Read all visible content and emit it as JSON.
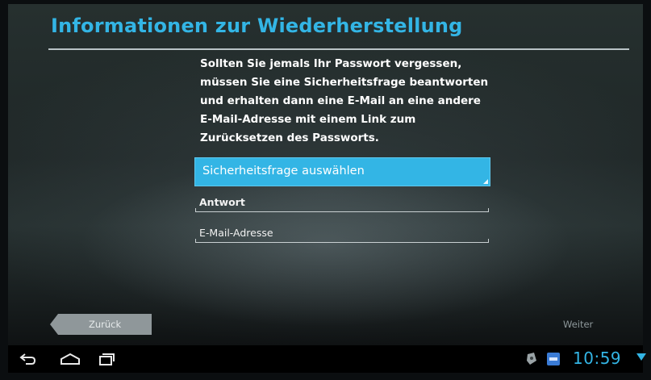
{
  "header": {
    "title": "Informationen zur Wiederherstellung"
  },
  "info_lines": [
    "Sollten Sie jemals Ihr Passwort vergessen,",
    "müssen Sie eine Sicherheitsfrage beantworten",
    "und erhalten dann eine E-Mail an eine andere",
    "E-Mail-Adresse mit einem Link zum",
    "Zurücksetzen des Passworts."
  ],
  "form": {
    "security_question_label": "Sicherheitsfrage auswählen",
    "answer_placeholder": "Antwort",
    "email_placeholder": "E-Mail-Adresse"
  },
  "footer": {
    "back_label": "Zurück",
    "next_label": "Weiter"
  },
  "system_bar": {
    "clock": "10:59",
    "icons": [
      "back-icon",
      "home-icon",
      "recent-apps-icon",
      "notification-icon",
      "store-icon",
      "wifi-icon"
    ]
  },
  "colors": {
    "accent": "#33b5e5",
    "background": "#232c2c",
    "navbar": "#000000"
  }
}
